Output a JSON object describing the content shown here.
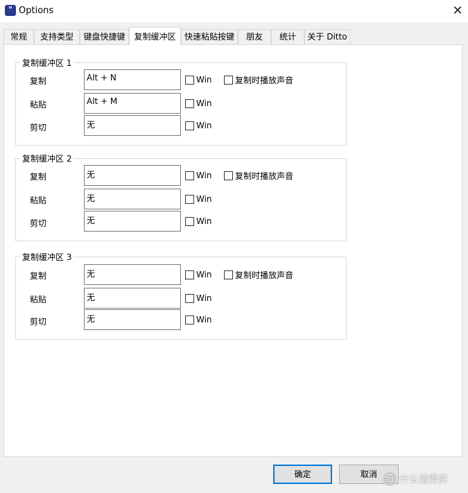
{
  "window": {
    "title": "Options",
    "icon_label": "\""
  },
  "tabs": [
    {
      "label": "常规"
    },
    {
      "label": "支持类型"
    },
    {
      "label": "键盘快捷键"
    },
    {
      "label": "复制缓冲区"
    },
    {
      "label": "快速粘贴按键"
    },
    {
      "label": "朋友"
    },
    {
      "label": "统计"
    },
    {
      "label": "关于 Ditto"
    }
  ],
  "active_tab": "复制缓冲区",
  "groups": [
    {
      "title": "复制缓冲区 1",
      "rows": [
        {
          "label": "复制",
          "value": "Alt + N"
        },
        {
          "label": "粘贴",
          "value": "Alt + M"
        },
        {
          "label": "剪切",
          "value": "无"
        }
      ]
    },
    {
      "title": "复制缓冲区 2",
      "rows": [
        {
          "label": "复制",
          "value": "无"
        },
        {
          "label": "粘贴",
          "value": "无"
        },
        {
          "label": "剪切",
          "value": "无"
        }
      ]
    },
    {
      "title": "复制缓冲区 3",
      "rows": [
        {
          "label": "复制",
          "value": "无"
        },
        {
          "label": "粘贴",
          "value": "无"
        },
        {
          "label": "剪切",
          "value": "无"
        }
      ]
    }
  ],
  "win_label": "Win",
  "play_sound_label": "复制时播放声音",
  "buttons": {
    "ok": "确定",
    "cancel": "取消"
  },
  "watermark": {
    "badge": "值",
    "text": "什么值得买"
  }
}
